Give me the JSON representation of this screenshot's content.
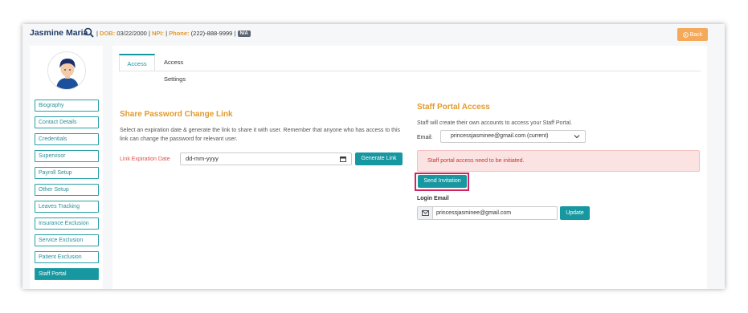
{
  "header": {
    "patient_name": "Jasmine Maria",
    "dob_label": "DOB:",
    "dob_value": "03/22/2000",
    "npi_label": "NPI:",
    "phone_label": "Phone:",
    "phone_value": "(222)-888-9999",
    "badge": "N/A",
    "back_label": "Back",
    "separator": "|"
  },
  "sidebar": {
    "items": [
      {
        "label": "Biography"
      },
      {
        "label": "Contact Details"
      },
      {
        "label": "Credentials"
      },
      {
        "label": "Supervisor"
      },
      {
        "label": "Payroll Setup"
      },
      {
        "label": "Other Setup"
      },
      {
        "label": "Leaves Tracking"
      },
      {
        "label": "Insurance Exclusion"
      },
      {
        "label": "Service Exclusion"
      },
      {
        "label": "Patient Exclusion"
      },
      {
        "label": "Staff Portal"
      }
    ],
    "active": "Staff Portal"
  },
  "tabs": [
    {
      "label": "Access"
    },
    {
      "label": "Access Settings"
    }
  ],
  "share": {
    "title": "Share Password Change Link",
    "description": "Select an expiration date & generate the link to share it with user. Remember that anyone who has access to this link can change the password for relevant user.",
    "expiration_label": "Link Expiration Date",
    "date_placeholder": "dd-mm-yyyy",
    "generate_label": "Generate Link"
  },
  "staff_portal": {
    "title": "Staff Portal Access",
    "subtitle": "Staff will create their own accounts to access your Staff Portal.",
    "email_label": "Email:",
    "email_value": "princessjasminee@gmail.com (current)",
    "alert": "Staff portal access need to be initiated.",
    "send_label": "Send Invitation",
    "login_label": "Login Email",
    "login_value": "princessjasminee@gmail.com",
    "update_label": "Update"
  },
  "colors": {
    "accent": "#1797a0",
    "orange": "#e39a2b",
    "alert_bg": "#fbe3e3",
    "highlight": "#d0245e"
  }
}
